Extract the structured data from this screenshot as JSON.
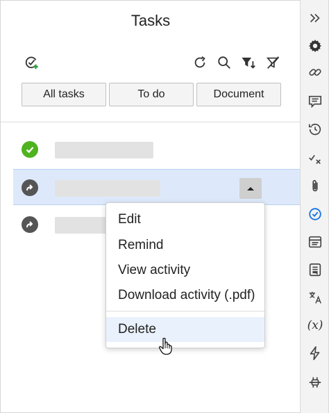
{
  "panel": {
    "title": "Tasks",
    "tabs": [
      {
        "label": "All tasks"
      },
      {
        "label": "To do"
      },
      {
        "label": "Document"
      }
    ]
  },
  "context_menu": {
    "items": [
      {
        "label": "Edit"
      },
      {
        "label": "Remind"
      },
      {
        "label": "View activity"
      },
      {
        "label": "Download activity (.pdf)"
      }
    ],
    "delete_label": "Delete"
  },
  "rail": {
    "variables_label": "(x)"
  },
  "colors": {
    "accent": "#1473e6",
    "done": "#4fb320",
    "selected_row": "#dde9fb"
  }
}
